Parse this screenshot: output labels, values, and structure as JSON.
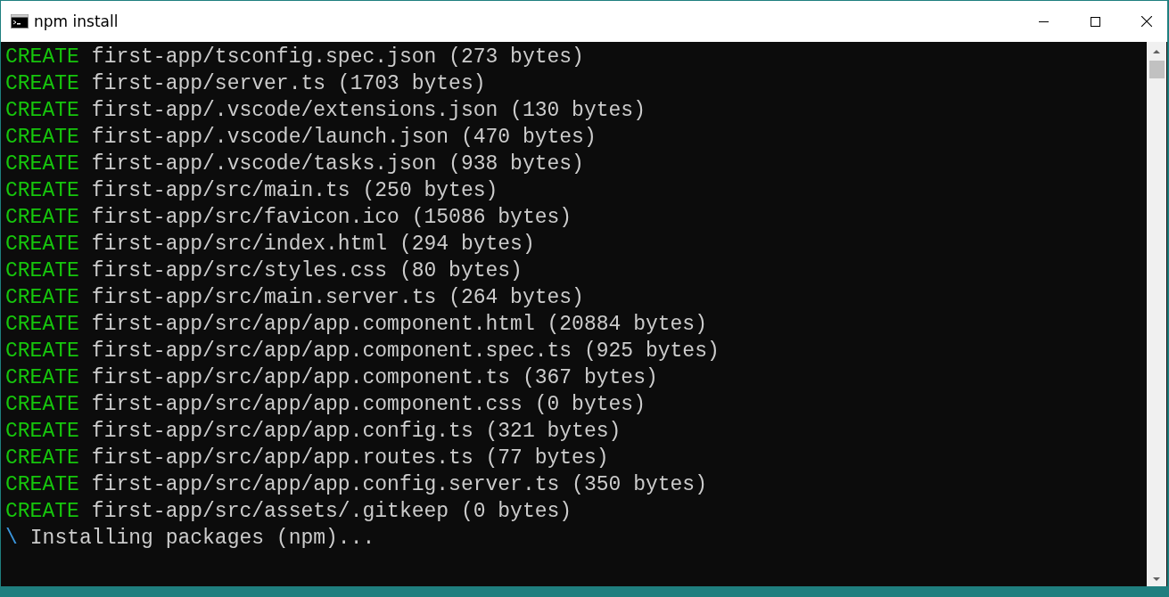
{
  "window": {
    "title": "npm install"
  },
  "lines": [
    {
      "kind": "create",
      "status": "CREATE",
      "text": "first-app/tsconfig.spec.json (273 bytes)"
    },
    {
      "kind": "create",
      "status": "CREATE",
      "text": "first-app/server.ts (1703 bytes)"
    },
    {
      "kind": "create",
      "status": "CREATE",
      "text": "first-app/.vscode/extensions.json (130 bytes)"
    },
    {
      "kind": "create",
      "status": "CREATE",
      "text": "first-app/.vscode/launch.json (470 bytes)"
    },
    {
      "kind": "create",
      "status": "CREATE",
      "text": "first-app/.vscode/tasks.json (938 bytes)"
    },
    {
      "kind": "create",
      "status": "CREATE",
      "text": "first-app/src/main.ts (250 bytes)"
    },
    {
      "kind": "create",
      "status": "CREATE",
      "text": "first-app/src/favicon.ico (15086 bytes)"
    },
    {
      "kind": "create",
      "status": "CREATE",
      "text": "first-app/src/index.html (294 bytes)"
    },
    {
      "kind": "create",
      "status": "CREATE",
      "text": "first-app/src/styles.css (80 bytes)"
    },
    {
      "kind": "create",
      "status": "CREATE",
      "text": "first-app/src/main.server.ts (264 bytes)"
    },
    {
      "kind": "create",
      "status": "CREATE",
      "text": "first-app/src/app/app.component.html (20884 bytes)"
    },
    {
      "kind": "create",
      "status": "CREATE",
      "text": "first-app/src/app/app.component.spec.ts (925 bytes)"
    },
    {
      "kind": "create",
      "status": "CREATE",
      "text": "first-app/src/app/app.component.ts (367 bytes)"
    },
    {
      "kind": "create",
      "status": "CREATE",
      "text": "first-app/src/app/app.component.css (0 bytes)"
    },
    {
      "kind": "create",
      "status": "CREATE",
      "text": "first-app/src/app/app.config.ts (321 bytes)"
    },
    {
      "kind": "create",
      "status": "CREATE",
      "text": "first-app/src/app/app.routes.ts (77 bytes)"
    },
    {
      "kind": "create",
      "status": "CREATE",
      "text": "first-app/src/app/app.config.server.ts (350 bytes)"
    },
    {
      "kind": "create",
      "status": "CREATE",
      "text": "first-app/src/assets/.gitkeep (0 bytes)"
    },
    {
      "kind": "spinner",
      "status": "\\",
      "text": "Installing packages (npm)..."
    }
  ]
}
